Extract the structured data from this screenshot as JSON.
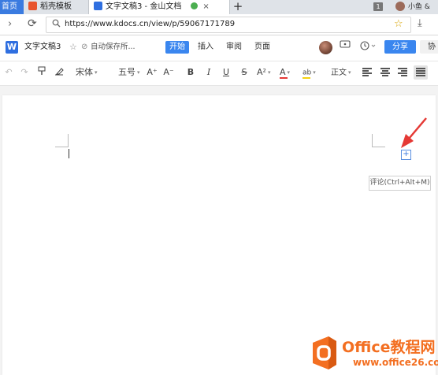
{
  "browser": {
    "tabs": [
      {
        "label": "首页"
      },
      {
        "label": "稻壳模板"
      },
      {
        "label": "文字文稿3 - 金山文档"
      }
    ],
    "tab_close": "×",
    "new_tab": "+",
    "tab_count": "1",
    "user_name": "小鱼 &",
    "url": "https://www.kdocs.cn/view/p/59067171789"
  },
  "app": {
    "logo_letter": "W",
    "doc_title": "文字文稿3",
    "save_status": "自动保存所...",
    "menu_tabs": [
      {
        "label": "开始",
        "active": true
      },
      {
        "label": "插入"
      },
      {
        "label": "审阅"
      },
      {
        "label": "页面"
      }
    ],
    "share_label": "分享",
    "collab_label": "协"
  },
  "toolbar": {
    "font_name": "宋体",
    "font_size": "五号",
    "grow_font": "A⁺",
    "shrink_font": "A⁻",
    "bold": "B",
    "italic": "I",
    "underline": "U",
    "strikethrough": "S",
    "superscript": "A²",
    "font_color": "A",
    "highlight": "ab",
    "style": "正文"
  },
  "document": {
    "comment_add_symbol": "+",
    "comment_tooltip": "评论(Ctrl+Alt+M)"
  },
  "watermark": {
    "title": "Office教程网",
    "url": "www.office26.com"
  },
  "colors": {
    "accent": "#3a86ef",
    "annotation_arrow": "#e53935",
    "watermark": "#f36f21"
  }
}
